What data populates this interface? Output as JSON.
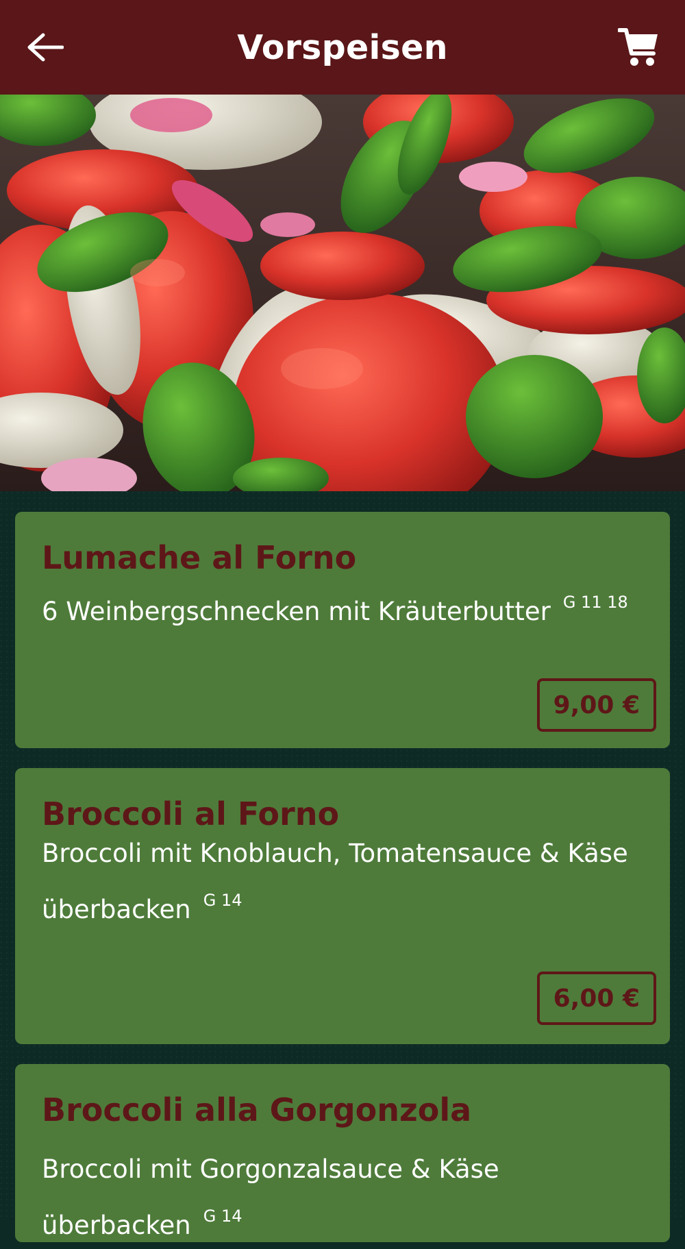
{
  "header": {
    "title": "Vorspeisen",
    "back_icon": "arrow-left-icon",
    "cart_icon": "shopping-cart-icon"
  },
  "hero": {
    "image": "caprese-salad-photo"
  },
  "menu": {
    "items": [
      {
        "title": "Lumache al Forno",
        "desc": "6 Weinbergschnecken mit Kräuterbutter",
        "allergens": "G 11 18",
        "price": "9,00 €"
      },
      {
        "title": "Broccoli al Forno",
        "desc": "Broccoli mit Knoblauch, Tomatensauce & Käse überbacken",
        "allergens": "G 14",
        "price": "6,00 €"
      },
      {
        "title": "Broccoli alla Gorgonzola",
        "desc": "Broccoli mit Gorgonzalsauce & Käse überbacken",
        "allergens": "G 14",
        "price": ""
      }
    ]
  },
  "colors": {
    "header_bg": "#5a1618",
    "page_bg": "#0d2a25",
    "card_bg": "#4e7b3a",
    "accent": "#5e1718",
    "text": "#ffffff"
  }
}
